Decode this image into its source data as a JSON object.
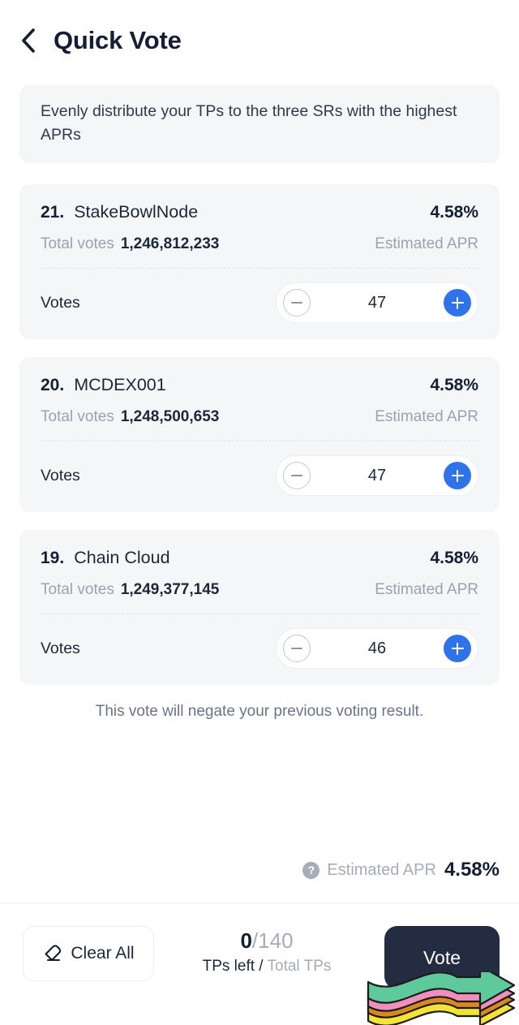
{
  "header": {
    "back_icon": "chevron-left-icon",
    "title": "Quick Vote"
  },
  "info_banner": {
    "text": "Evenly distribute your TPs to the three SRs with the highest APRs"
  },
  "labels": {
    "total_votes": "Total votes",
    "estimated_apr": "Estimated APR",
    "votes": "Votes",
    "minus_icon": "minus-icon",
    "plus_icon": "plus-icon"
  },
  "cards": [
    {
      "rank": "21.",
      "name": "StakeBowlNode",
      "apr": "4.58%",
      "total_votes": "1,246,812,233",
      "votes": "47"
    },
    {
      "rank": "20.",
      "name": "MCDEX001",
      "apr": "4.58%",
      "total_votes": "1,248,500,653",
      "votes": "47"
    },
    {
      "rank": "19.",
      "name": "Chain Cloud",
      "apr": "4.58%",
      "total_votes": "1,249,377,145",
      "votes": "46"
    }
  ],
  "negate_note": "This vote will negate your previous voting result.",
  "footer_apr": {
    "help_icon": "question-mark-icon",
    "label": "Estimated APR",
    "value": "4.58%"
  },
  "bottom_bar": {
    "clear_all_icon": "eraser-icon",
    "clear_all_label": "Clear All",
    "tps_left": "0",
    "tps_separator": "/",
    "tps_total": "140",
    "tps_caption_left": "TPs left / ",
    "tps_caption_right": "Total TPs",
    "vote_label": "Vote"
  },
  "colors": {
    "accent_blue": "#2f73ea",
    "dark_navy": "#242c41",
    "card_bg": "#f4f6f8",
    "muted_text": "#9aa3b2",
    "arrow_green": "#5ec99a",
    "arrow_pink": "#ef8fbe",
    "arrow_orange": "#d98a1e",
    "arrow_yellow": "#f2e335"
  }
}
